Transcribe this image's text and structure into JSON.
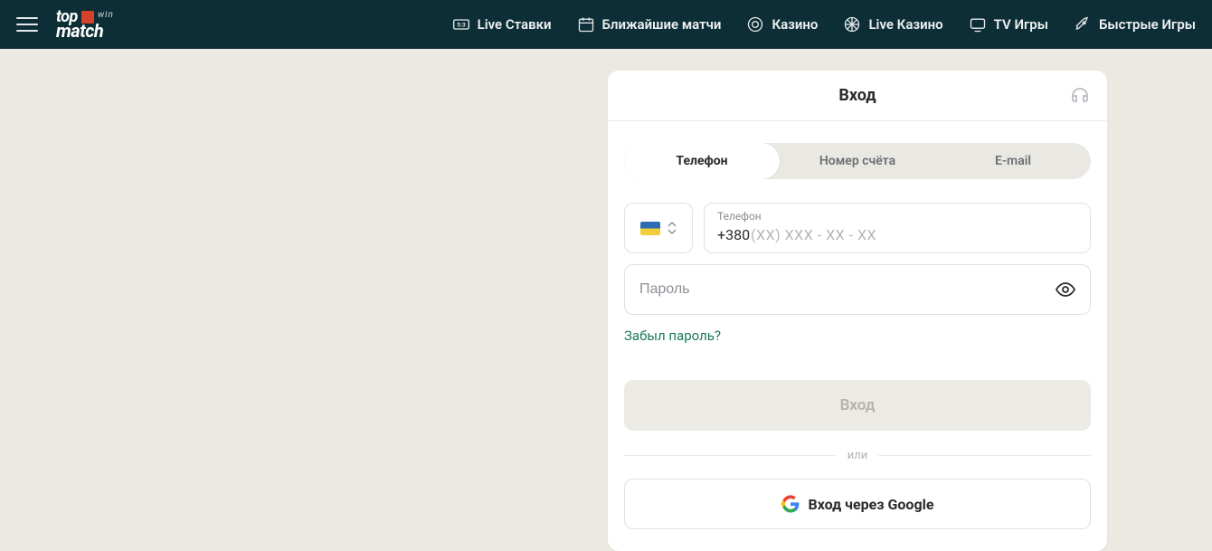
{
  "nav": {
    "live_bets": "Live Ставки",
    "upcoming": "Ближайшие матчи",
    "casino": "Казино",
    "live_casino": "Live Казино",
    "tv_games": "TV Игры",
    "fast_games": "Быстрые Игры"
  },
  "logo": {
    "top": "top",
    "win": "win",
    "bottom": "match"
  },
  "card": {
    "title": "Вход",
    "tabs": {
      "phone": "Телефон",
      "account": "Номер счёта",
      "email": "E-mail"
    },
    "phone_label": "Телефон",
    "phone_prefix": "+380",
    "phone_mask": "(XX) XXX - XX - XX",
    "password_placeholder": "Пароль",
    "forgot": "Забыл пароль?",
    "login_button": "Вход",
    "divider": "или",
    "google_button": "Вход через Google"
  }
}
